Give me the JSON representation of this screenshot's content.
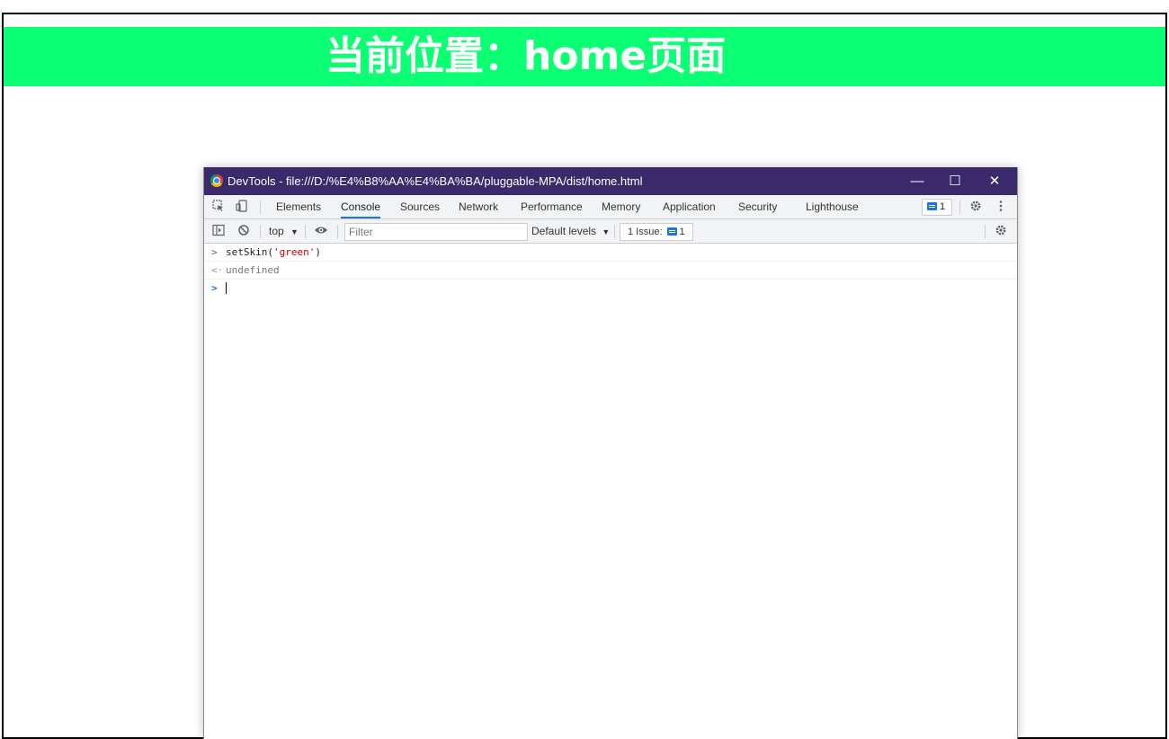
{
  "banner": {
    "title": "当前位置：home页面"
  },
  "window": {
    "title": "DevTools - file:///D:/%E4%B8%AA%E4%BA%BA/pluggable-MPA/dist/home.html",
    "minimize_glyph": "—",
    "maximize_glyph": "☐",
    "close_glyph": "✕"
  },
  "tabs": [
    {
      "label": "Elements"
    },
    {
      "label": "Console"
    },
    {
      "label": "Sources"
    },
    {
      "label": "Network"
    },
    {
      "label": "Performance"
    },
    {
      "label": "Memory"
    },
    {
      "label": "Application"
    },
    {
      "label": "Security"
    },
    {
      "label": "Lighthouse"
    }
  ],
  "active_tab": "Console",
  "issues_badge_count": "1",
  "toolbar": {
    "context": "top",
    "filter_placeholder": "Filter",
    "levels": "Default levels",
    "issues_label": "1 Issue:",
    "issues_count": "1"
  },
  "console": {
    "entries": [
      {
        "type": "input",
        "prompt": ">",
        "fn": "setSkin(",
        "arg": "'green'",
        "close": ")"
      },
      {
        "type": "result",
        "prompt": "<·",
        "text": "undefined"
      }
    ],
    "active_prompt": ">"
  },
  "colors": {
    "banner": "#0bff72",
    "titlebar": "#3b2a6b",
    "accent": "#1a73e8"
  }
}
